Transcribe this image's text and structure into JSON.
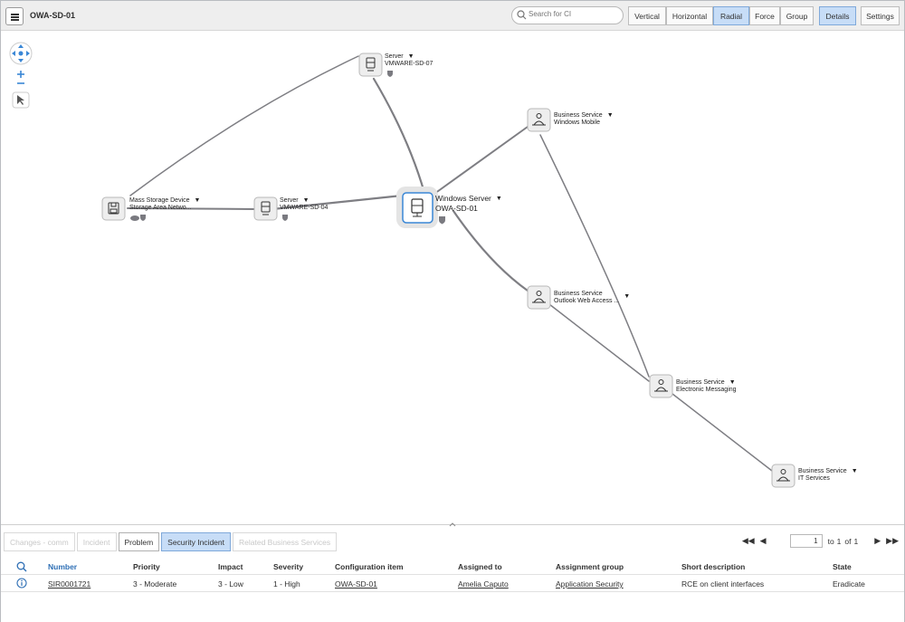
{
  "app": {
    "title": "OWA-SD-01"
  },
  "search": {
    "placeholder": "Search for CI"
  },
  "toolbar": {
    "layouts": [
      {
        "label": "Vertical",
        "active": false
      },
      {
        "label": "Horizontal",
        "active": false
      },
      {
        "label": "Radial",
        "active": true
      },
      {
        "label": "Force",
        "active": false
      },
      {
        "label": "Group",
        "active": false
      }
    ],
    "details_label": "Details",
    "settings_label": "Settings"
  },
  "map": {
    "nodes": [
      {
        "id": "n-root",
        "type": "Windows Server",
        "name": "OWA-SD-01"
      },
      {
        "id": "n-vm07",
        "type": "Server",
        "name": "VMWARE-SD-07"
      },
      {
        "id": "n-vm04",
        "type": "Server",
        "name": "VMWARE-SD-04"
      },
      {
        "id": "n-msd",
        "type": "Mass Storage Device",
        "name": "Storage Area Netwo..."
      },
      {
        "id": "n-wm",
        "type": "Business Service",
        "name": "Windows Mobile"
      },
      {
        "id": "n-owa",
        "type": "Business Service",
        "name": "Outlook Web Access ..."
      },
      {
        "id": "n-em",
        "type": "Business Service",
        "name": "Electronic Messaging"
      },
      {
        "id": "n-it",
        "type": "Business Service",
        "name": "IT Services"
      }
    ]
  },
  "bottom": {
    "tabs": [
      {
        "label": "Changes - comm",
        "state": "disabled"
      },
      {
        "label": "Incident",
        "state": "disabled"
      },
      {
        "label": "Problem",
        "state": "enabled"
      },
      {
        "label": "Security Incident",
        "state": "selected"
      },
      {
        "label": "Related Business Services",
        "state": "disabled"
      }
    ],
    "pager": {
      "page": "1",
      "to_label": "to",
      "to_value": "1",
      "of_label": "of",
      "of_value": "1"
    },
    "table": {
      "columns": [
        "Number",
        "Priority",
        "Impact",
        "Severity",
        "Configuration item",
        "Assigned to",
        "Assignment group",
        "Short description",
        "State"
      ],
      "rows": [
        {
          "number": "SIR0001721",
          "priority": "3 - Moderate",
          "impact": "3 - Low",
          "severity": "1 - High",
          "ci": "OWA-SD-01",
          "assigned_to": "Amelia Caputo",
          "group": "Application Security",
          "description": "RCE on client interfaces",
          "state": "Eradicate"
        }
      ]
    }
  },
  "colors": {
    "accent": "#2e6fb5",
    "active_bg": "#c7ddf7",
    "edge": "#7e7e83"
  }
}
